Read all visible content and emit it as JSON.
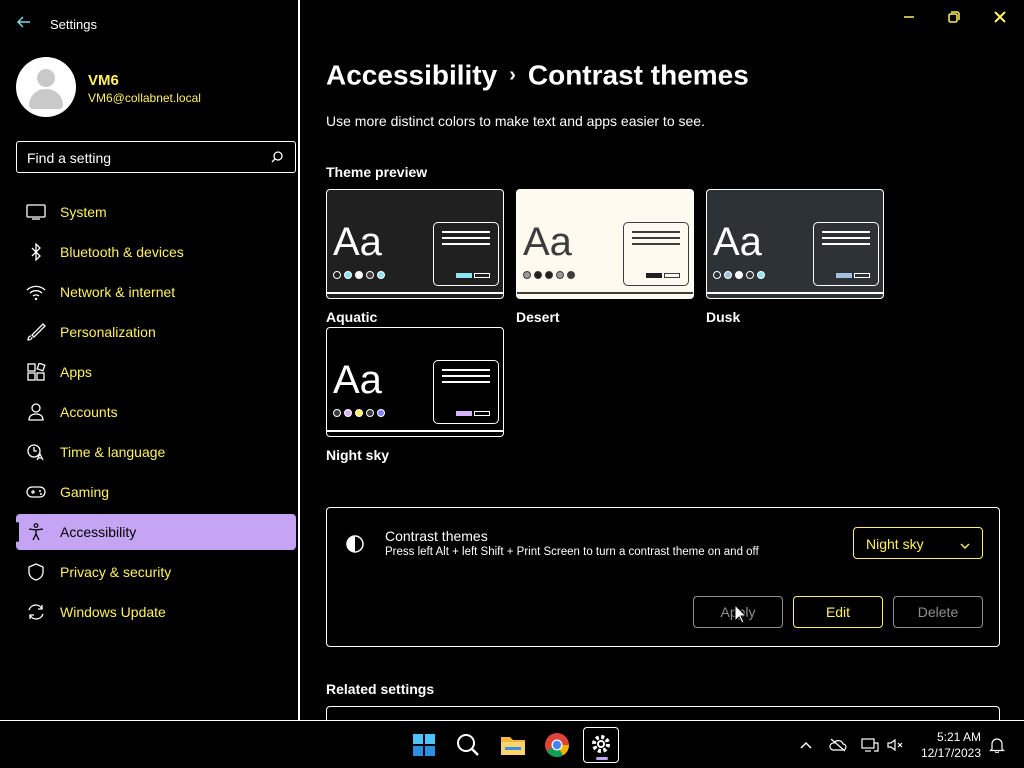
{
  "window": {
    "title": "Settings",
    "controls": [
      "minimize",
      "restore",
      "close"
    ]
  },
  "user": {
    "name": "VM6",
    "email": "VM6@collabnet.local"
  },
  "search": {
    "placeholder": "Find a setting"
  },
  "nav": {
    "items": [
      {
        "label": "System",
        "icon": "monitor-icon"
      },
      {
        "label": "Bluetooth & devices",
        "icon": "bluetooth-icon"
      },
      {
        "label": "Network & internet",
        "icon": "wifi-icon"
      },
      {
        "label": "Personalization",
        "icon": "brush-icon"
      },
      {
        "label": "Apps",
        "icon": "apps-icon"
      },
      {
        "label": "Accounts",
        "icon": "person-icon"
      },
      {
        "label": "Time & language",
        "icon": "globe-clock-icon"
      },
      {
        "label": "Gaming",
        "icon": "gamepad-icon"
      },
      {
        "label": "Accessibility",
        "icon": "accessibility-icon",
        "selected": true
      },
      {
        "label": "Privacy & security",
        "icon": "shield-icon"
      },
      {
        "label": "Windows Update",
        "icon": "update-icon"
      }
    ]
  },
  "page": {
    "breadcrumb_parent": "Accessibility",
    "breadcrumb_sep": "›",
    "title": "Contrast themes",
    "description": "Use more distinct colors to make text and apps easier to see.",
    "preview_heading": "Theme preview",
    "themes": [
      {
        "name": "Aquatic",
        "bg": "#202020",
        "fg": "#ffffff",
        "dots": [
          "#202020",
          "#8ee3f0",
          "#ffffff",
          "#3a3a3a",
          "#8ee3f0"
        ],
        "accent": "#8ee3f0"
      },
      {
        "name": "Desert",
        "bg": "#fffaef",
        "fg": "#3d3d3d",
        "dots": [
          "#9a9a9a",
          "#202020",
          "#202020",
          "#9a9a9a",
          "#3d3d3d"
        ],
        "accent": "#202020"
      },
      {
        "name": "Dusk",
        "bg": "#2d3236",
        "fg": "#ffffff",
        "dots": [
          "#2d3236",
          "#a1bfde",
          "#ffffff",
          "#2d3236",
          "#8ee3f0"
        ],
        "accent": "#a1bfde"
      },
      {
        "name": "Night sky",
        "bg": "#000000",
        "fg": "#ffffff",
        "dots": [
          "#3a3a3a",
          "#d6b4fd",
          "#fff15f",
          "#3a3a3a",
          "#8080ff"
        ],
        "accent": "#d6b4fd"
      }
    ],
    "contrast_panel": {
      "title": "Contrast themes",
      "subtitle": "Press left Alt + left Shift + Print Screen to turn a contrast theme on and off",
      "selected_theme": "Night sky",
      "apply_label": "Apply",
      "edit_label": "Edit",
      "delete_label": "Delete"
    },
    "related_heading": "Related settings"
  },
  "taskbar": {
    "time": "5:21 AM",
    "date": "12/17/2023"
  },
  "colors": {
    "accent": "#c6a4f4",
    "text_yellow": "#fff15f",
    "disabled": "#8f8f8f"
  }
}
